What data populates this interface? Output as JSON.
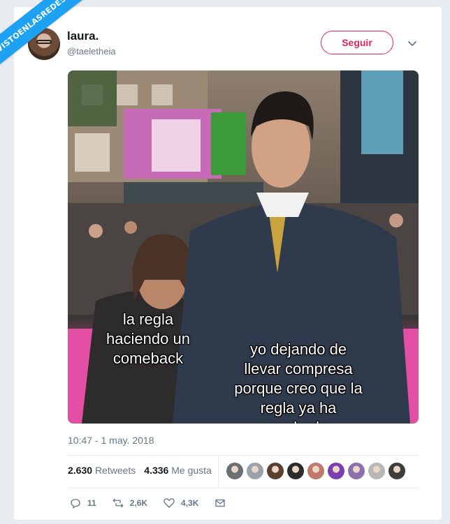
{
  "watermark": {
    "text": "VISTOENLASREDES"
  },
  "user": {
    "name": "laura.",
    "handle": "@taeletheia"
  },
  "follow_label": "Seguir",
  "image": {
    "caption_left": "la regla\nhaciendo un\ncomeback",
    "caption_right": "yo dejando de\nllevar compresa\nporque creo que la\nregla ya ha\nacabado"
  },
  "timestamp": "10:47 - 1 may. 2018",
  "stats": {
    "retweets_count": "2.630",
    "retweets_label": "Retweets",
    "likes_count": "4.336",
    "likes_label": "Me gusta"
  },
  "liker_colors": [
    "#6b6f73",
    "#9aa3ab",
    "#5b4030",
    "#2c2c2c",
    "#c0786a",
    "#7a3fb0",
    "#8c6fae",
    "#b8b8b8",
    "#3d3d3d"
  ],
  "actions": {
    "replies": "11",
    "retweets": "2,6K",
    "likes": "4,3K"
  },
  "colors": {
    "accent": "#e0245e",
    "muted": "#657786"
  }
}
